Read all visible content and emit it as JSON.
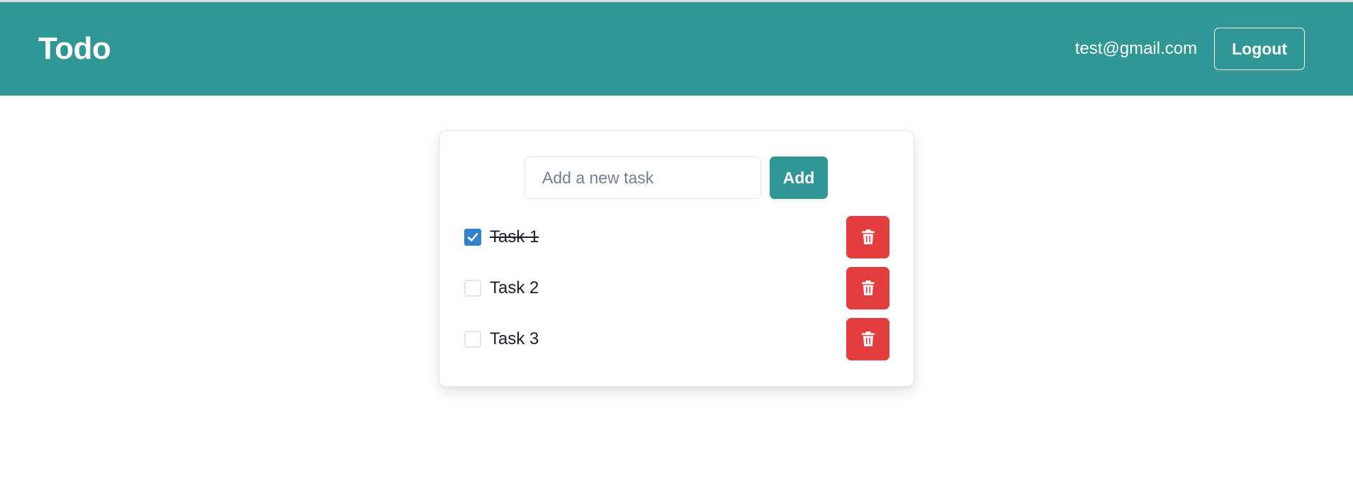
{
  "header": {
    "title": "Todo",
    "user_email": "test@gmail.com",
    "logout_label": "Logout",
    "brand_color": "#319795"
  },
  "composer": {
    "placeholder": "Add a new task",
    "value": "",
    "add_label": "Add"
  },
  "tasks": [
    {
      "label": "Task 1",
      "completed": true
    },
    {
      "label": "Task 2",
      "completed": false
    },
    {
      "label": "Task 3",
      "completed": false
    }
  ],
  "icons": {
    "check": "check-icon",
    "delete": "trash-icon"
  },
  "colors": {
    "checkbox_checked": "#3182ce",
    "delete_button": "#e53e3e"
  }
}
